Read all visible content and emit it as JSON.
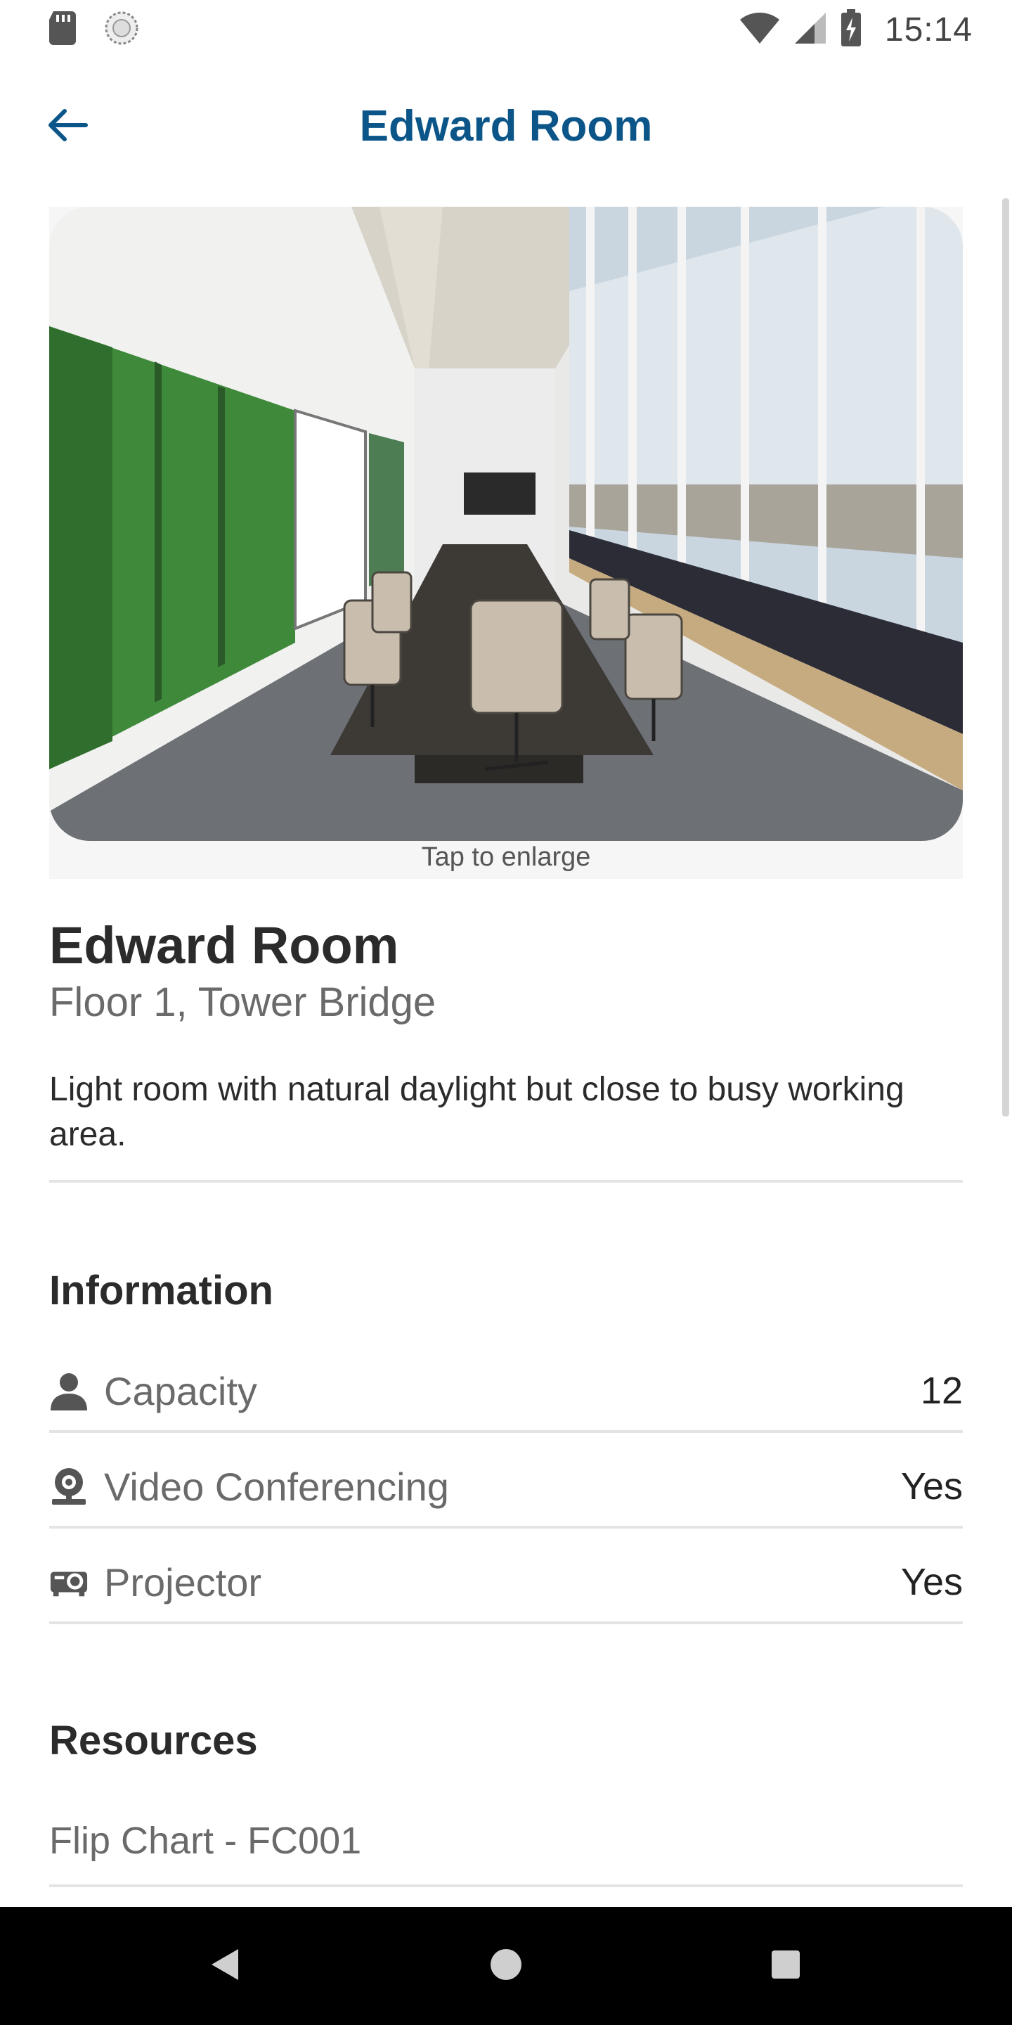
{
  "status_bar": {
    "time": "15:14",
    "icons": [
      "sd-card-icon",
      "sync-icon",
      "wifi-icon",
      "cell-signal-icon",
      "battery-charging-icon"
    ]
  },
  "app_bar": {
    "title": "Edward Room",
    "back_icon": "arrow-left-icon"
  },
  "photo": {
    "alt": "Conference room photo",
    "hint": "Tap to enlarge"
  },
  "room": {
    "name": "Edward Room",
    "location": "Floor 1, Tower Bridge",
    "description": "Light room with natural daylight but close to busy working area."
  },
  "information": {
    "heading": "Information",
    "rows": [
      {
        "icon": "person-icon",
        "label": "Capacity",
        "value": "12"
      },
      {
        "icon": "webcam-icon",
        "label": "Video Conferencing",
        "value": "Yes"
      },
      {
        "icon": "projector-icon",
        "label": "Projector",
        "value": "Yes"
      }
    ]
  },
  "resources": {
    "heading": "Resources",
    "items": [
      {
        "label": "Flip Chart - FC001"
      }
    ]
  },
  "nav_bar": {
    "buttons": [
      "back-triangle-icon",
      "home-circle-icon",
      "recents-square-icon"
    ]
  },
  "colors": {
    "accent": "#0b5589",
    "text_primary": "#2b2b2b",
    "text_secondary": "#6a6a6a",
    "divider": "#e4e4e4",
    "nav_bar": "#000000"
  }
}
